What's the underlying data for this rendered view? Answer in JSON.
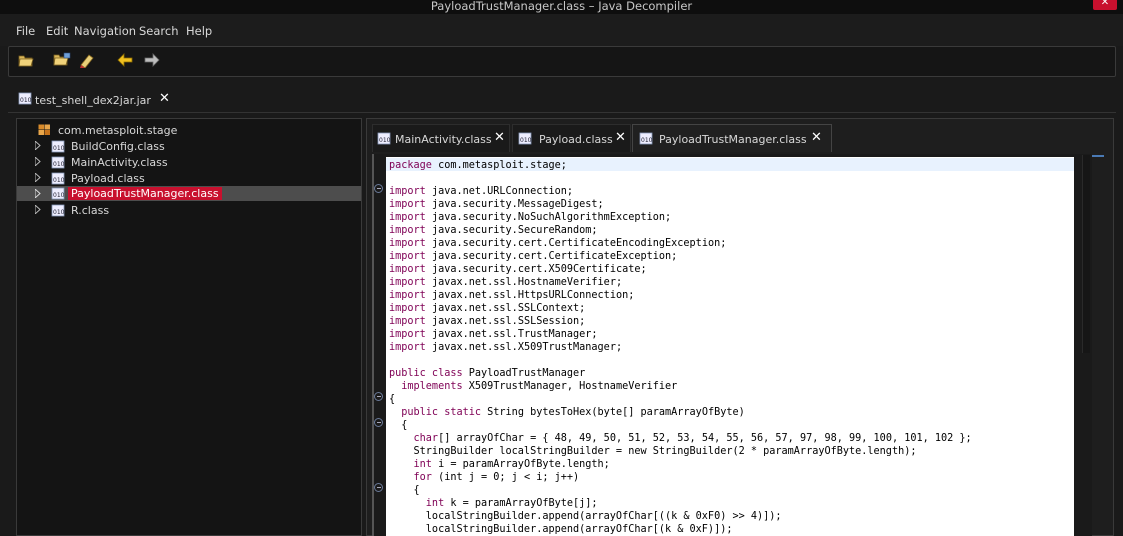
{
  "window": {
    "title": "PayloadTrustManager.class – Java Decompiler",
    "close_glyph": "✕"
  },
  "menu": [
    "File",
    "Edit",
    "Navigation",
    "Search",
    "Help"
  ],
  "toolbar": {
    "buttons": [
      "open-file-icon",
      "open-folder-icon",
      "clear-icon",
      "back-arrow-icon",
      "forward-arrow-icon"
    ]
  },
  "jar_tab": {
    "label": "test_shell_dex2jar.jar",
    "close_glyph": "✕"
  },
  "tree": {
    "package": "com.metasploit.stage",
    "items": [
      {
        "label": "BuildConfig.class",
        "selected": false
      },
      {
        "label": "MainActivity.class",
        "selected": false
      },
      {
        "label": "Payload.class",
        "selected": false
      },
      {
        "label": "PayloadTrustManager.class",
        "selected": true
      },
      {
        "label": "R.class",
        "selected": false
      }
    ]
  },
  "editor_tabs": [
    {
      "label": "MainActivity.class",
      "close_glyph": "✕",
      "active": false
    },
    {
      "label": "Payload.class",
      "close_glyph": "✕",
      "active": false
    },
    {
      "label": "PayloadTrustManager.class",
      "close_glyph": "✕",
      "active": true
    }
  ],
  "code_lines": [
    [
      "package",
      " com.metasploit.stage;"
    ],
    [
      "",
      ""
    ],
    [
      "import",
      " java.net.URLConnection;"
    ],
    [
      "import",
      " java.security.MessageDigest;"
    ],
    [
      "import",
      " java.security.NoSuchAlgorithmException;"
    ],
    [
      "import",
      " java.security.SecureRandom;"
    ],
    [
      "import",
      " java.security.cert.CertificateEncodingException;"
    ],
    [
      "import",
      " java.security.cert.CertificateException;"
    ],
    [
      "import",
      " java.security.cert.X509Certificate;"
    ],
    [
      "import",
      " javax.net.ssl.HostnameVerifier;"
    ],
    [
      "import",
      " javax.net.ssl.HttpsURLConnection;"
    ],
    [
      "import",
      " javax.net.ssl.SSLContext;"
    ],
    [
      "import",
      " javax.net.ssl.SSLSession;"
    ],
    [
      "import",
      " javax.net.ssl.TrustManager;"
    ],
    [
      "import",
      " javax.net.ssl.X509TrustManager;"
    ],
    [
      "",
      ""
    ],
    [
      "public class",
      " PayloadTrustManager"
    ],
    [
      "  implements",
      " X509TrustManager, HostnameVerifier"
    ],
    [
      "",
      "{"
    ],
    [
      "  public static",
      " String bytesToHex(byte[] paramArrayOfByte)"
    ],
    [
      "",
      "  {"
    ],
    [
      "    char",
      "[] arrayOfChar = { 48, 49, 50, 51, 52, 53, 54, 55, 56, 57, 97, 98, 99, 100, 101, 102 };"
    ],
    [
      "",
      "    StringBuilder localStringBuilder = new StringBuilder(2 * paramArrayOfByte.length);"
    ],
    [
      "    int",
      " i = paramArrayOfByte.length;"
    ],
    [
      "    for",
      " (int j = 0; j < i; j++)"
    ],
    [
      "",
      "    {"
    ],
    [
      "      int",
      " k = paramArrayOfByte[j];"
    ],
    [
      "",
      "      localStringBuilder.append(arrayOfChar[((k & 0xF0) >> 4)]);"
    ],
    [
      "",
      "      localStringBuilder.append(arrayOfChar[(k & 0xF)]);"
    ]
  ]
}
